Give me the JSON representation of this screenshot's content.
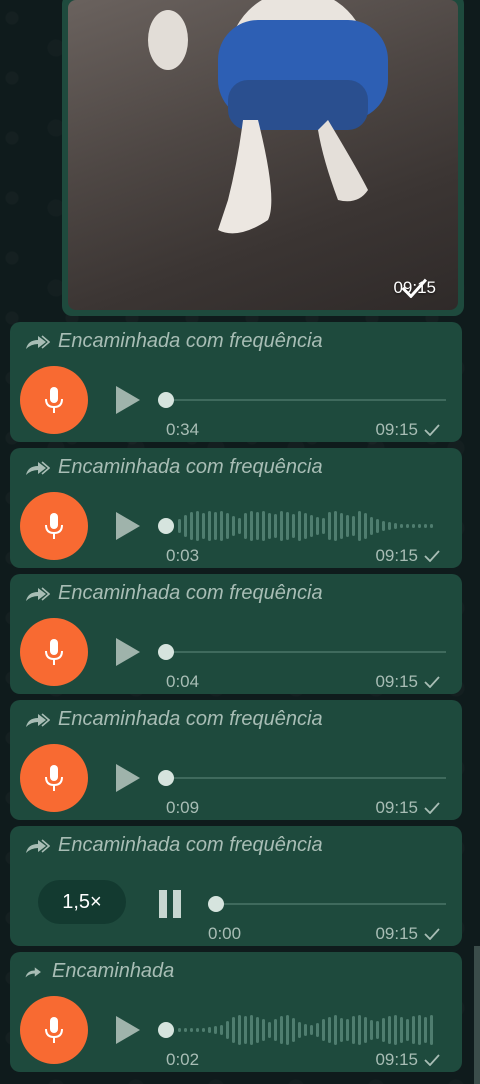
{
  "image_message": {
    "time": "09:15"
  },
  "voice_messages": [
    {
      "forward_label": "Encaminhada com frequência",
      "duration": "0:34",
      "time": "09:15"
    },
    {
      "forward_label": "Encaminhada com frequência",
      "duration": "0:03",
      "time": "09:15"
    },
    {
      "forward_label": "Encaminhada com frequência",
      "duration": "0:04",
      "time": "09:15"
    },
    {
      "forward_label": "Encaminhada com frequência",
      "duration": "0:09",
      "time": "09:15"
    },
    {
      "forward_label": "Encaminhada com frequência",
      "duration": "0:00",
      "time": "09:15",
      "speed": "1,5×"
    },
    {
      "forward_label": "Encaminhada",
      "duration": "0:02",
      "time": "09:15"
    }
  ],
  "colors": {
    "bubble": "#1e4a3d",
    "mic": "#f86a32",
    "meta": "#a8bdb5"
  }
}
